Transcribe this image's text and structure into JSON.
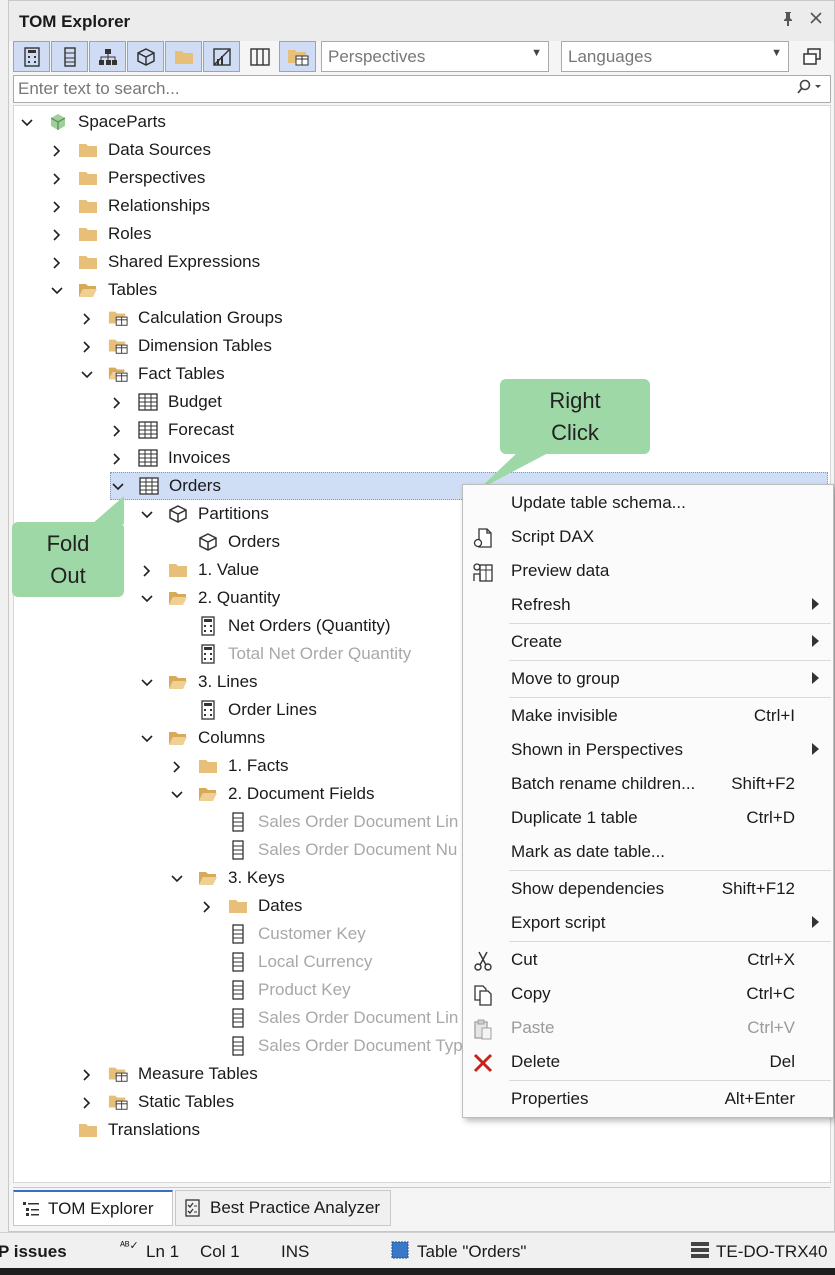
{
  "panel": {
    "title": "TOM Explorer"
  },
  "toolbar": {
    "perspectives_placeholder": "Perspectives",
    "languages_placeholder": "Languages"
  },
  "search": {
    "placeholder": "Enter text to search..."
  },
  "tree": {
    "root": "SpaceParts",
    "data_sources": "Data Sources",
    "perspectives": "Perspectives",
    "relationships": "Relationships",
    "roles": "Roles",
    "shared_expressions": "Shared Expressions",
    "tables": "Tables",
    "calculation_groups": "Calculation Groups",
    "dimension_tables": "Dimension Tables",
    "fact_tables": "Fact Tables",
    "budget": "Budget",
    "forecast": "Forecast",
    "invoices": "Invoices",
    "orders": "Orders",
    "partitions": "Partitions",
    "partition_orders": "Orders",
    "value_folder": "1. Value",
    "quantity_folder": "2. Quantity",
    "net_orders_quantity": "Net Orders (Quantity)",
    "total_net_order_quantity": "Total Net Order Quantity",
    "lines_folder": "3. Lines",
    "order_lines": "Order Lines",
    "columns": "Columns",
    "facts_folder": "1. Facts",
    "document_fields_folder": "2. Document Fields",
    "sales_order_document_line_1": "Sales Order Document Lin",
    "sales_order_document_number": "Sales Order Document Nu",
    "keys_folder": "3. Keys",
    "dates": "Dates",
    "customer_key": "Customer Key",
    "local_currency": "Local Currency",
    "product_key": "Product Key",
    "sales_order_document_line_2": "Sales Order Document Lin",
    "sales_order_document_type": "Sales Order Document Typ",
    "measure_tables": "Measure Tables",
    "static_tables": "Static Tables",
    "translations": "Translations"
  },
  "context_menu": {
    "update_table_schema": "Update table schema...",
    "script_dax": "Script DAX",
    "preview_data": "Preview data",
    "refresh": "Refresh",
    "create": "Create",
    "move_to_group": "Move to group",
    "make_invisible": "Make invisible",
    "make_invisible_shortcut": "Ctrl+I",
    "shown_in_perspectives": "Shown in Perspectives",
    "batch_rename_children": "Batch rename children...",
    "batch_rename_shortcut": "Shift+F2",
    "duplicate_table": "Duplicate 1 table",
    "duplicate_shortcut": "Ctrl+D",
    "mark_as_date_table": "Mark as date table...",
    "show_dependencies": "Show dependencies",
    "show_dependencies_shortcut": "Shift+F12",
    "export_script": "Export script",
    "cut": "Cut",
    "cut_shortcut": "Ctrl+X",
    "copy": "Copy",
    "copy_shortcut": "Ctrl+C",
    "paste": "Paste",
    "paste_shortcut": "Ctrl+V",
    "delete": "Delete",
    "delete_shortcut": "Del",
    "properties": "Properties",
    "properties_shortcut": "Alt+Enter"
  },
  "callouts": {
    "right_click": "Right Click",
    "fold_out": "Fold Out"
  },
  "bottom_tabs": {
    "tom_explorer": "TOM Explorer",
    "best_practice_analyzer": "Best Practice Analyzer"
  },
  "status": {
    "bp_issues": "P issues",
    "line": "Ln 1",
    "col": "Col 1",
    "mode": "INS",
    "selection": "Table \"Orders\"",
    "server": "TE-DO-TRX40"
  },
  "colors": {
    "selection": "#cfdef5",
    "folder": "#e8bf78",
    "callout": "#9ed8a6",
    "delete": "#c8231b"
  }
}
